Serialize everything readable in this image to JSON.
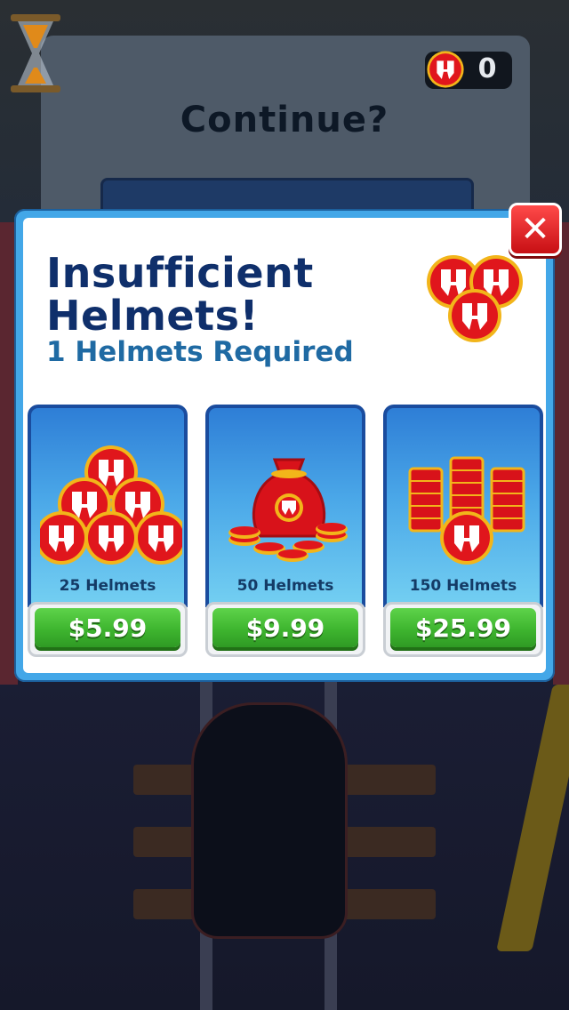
{
  "background": {
    "screen_title": "Continue?",
    "helmet_count": "0"
  },
  "dialog": {
    "title": "Insufficient Helmets!",
    "subtitle": "1 Helmets Required",
    "close_label": "✕"
  },
  "offers": [
    {
      "label": "25 Helmets",
      "price": "$5.99",
      "art": "helmet-pyramid-icon"
    },
    {
      "label": "50 Helmets",
      "price": "$9.99",
      "art": "helmet-sack-icon"
    },
    {
      "label": "150 Helmets",
      "price": "$25.99",
      "art": "helmet-stacks-icon"
    }
  ],
  "colors": {
    "dialog_border": "#43a7e8",
    "title_navy": "#0f2f6b",
    "subtitle_blue": "#1f6aa3",
    "buy_green": "#3eb52f",
    "close_red": "#e01c22",
    "helmet_red": "#e0161c",
    "helmet_gold": "#f2b51a"
  }
}
